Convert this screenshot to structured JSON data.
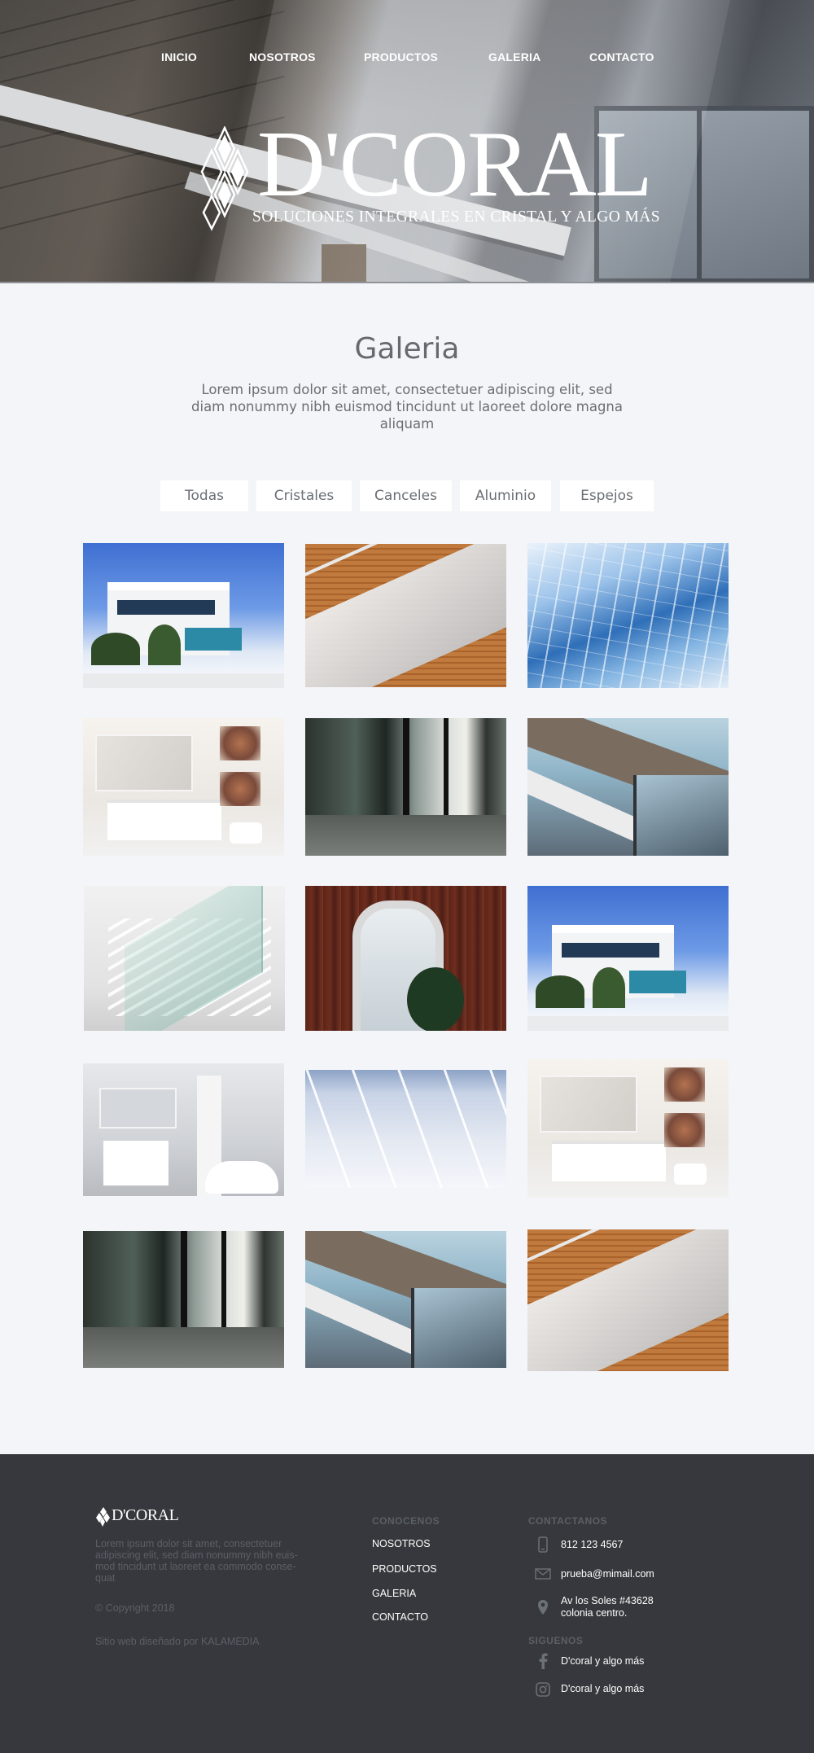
{
  "nav": {
    "items": [
      "INICIO",
      "NOSOTROS",
      "PRODUCTOS",
      "GALERIA",
      "CONTACTO"
    ]
  },
  "brand": {
    "name": "D'CORAL",
    "tagline": "SOLUCIONES INTEGRALES EN CRISTAL Y ALGO MÁS"
  },
  "gallery": {
    "title": "Galeria",
    "description": "Lorem ipsum dolor sit amet, consectetuer adipiscing elit, sed diam nonummy nibh euismod tincidunt ut laoreet dolore magna aliquam",
    "filters": [
      "Todas",
      "Cristales",
      "Canceles",
      "Aluminio",
      "Espejos"
    ]
  },
  "footer": {
    "logo": "D'CORAL",
    "about": "Lorem ipsum dolor sit amet, consectetuer adipiscing elit, sed diam nonummy nibh euis-mod tincidunt ut laoreet ea commodo conse-quat",
    "copyright": "© Copyright 2018",
    "credit": "Sitio web diseñado por KALAMEDIA",
    "conocenos_heading": "CONOCENOS",
    "links": [
      "NOSOTROS",
      "PRODUCTOS",
      "GALERIA",
      "CONTACTO"
    ],
    "contact_heading": "CONTACTANOS",
    "phone": "812 123 4567",
    "email": "prueba@mimail.com",
    "address_line1": "Av los Soles #43628",
    "address_line2": "colonia centro.",
    "follow_heading": "SIGUENOS",
    "facebook": "D'coral  y algo más",
    "instagram": "D'coral y algo más"
  },
  "colors": {
    "page_bg": "#f4f5f8",
    "footer_bg": "#36383d",
    "muted_text": "#5b5f66",
    "heading_text": "#666a70"
  }
}
